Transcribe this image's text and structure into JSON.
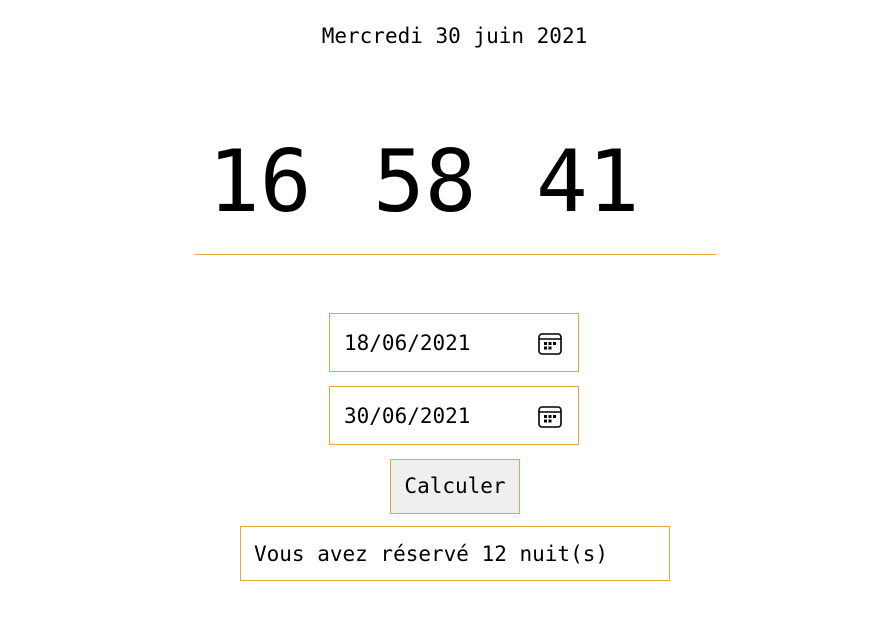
{
  "header": {
    "date": "Mercredi 30 juin 2021"
  },
  "clock": {
    "hours": "16",
    "minutes": "58",
    "seconds": "41"
  },
  "form": {
    "start_date": "18/06/2021",
    "end_date": "30/06/2021",
    "calendar_icon": "calendar-icon",
    "button_label": "Calculer"
  },
  "result": {
    "text": "Vous avez réservé 12 nuit(s)"
  },
  "colors": {
    "accent_border": "#e0a640",
    "button_background": "#efefef"
  }
}
